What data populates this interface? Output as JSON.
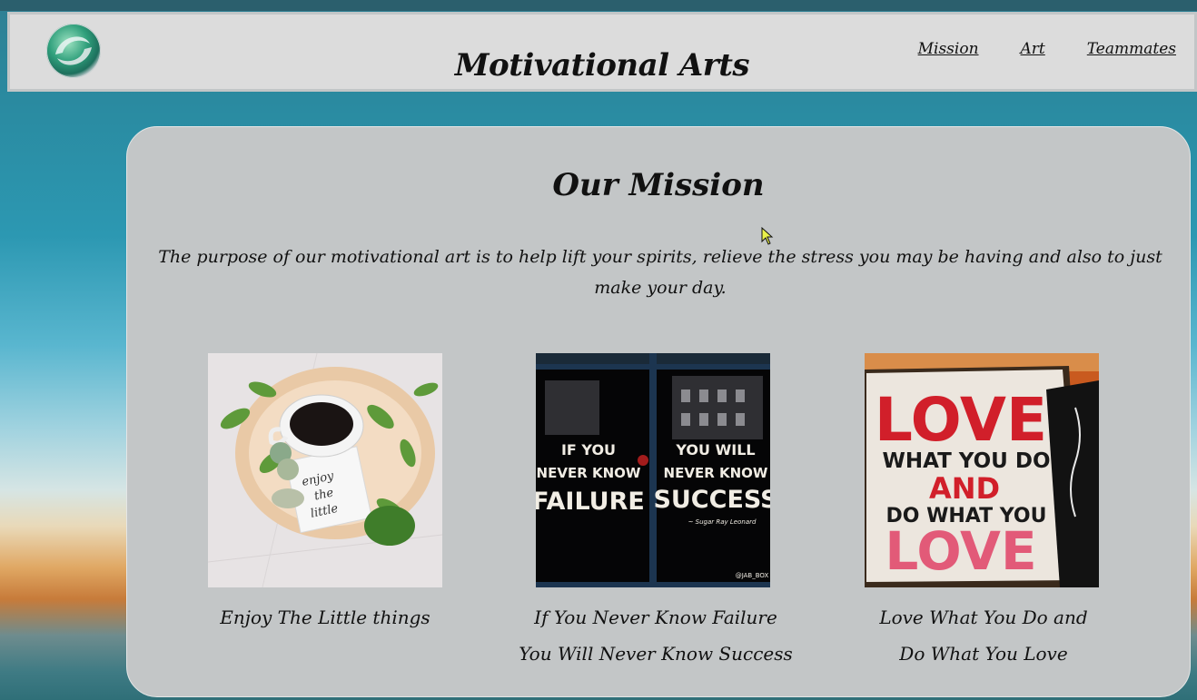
{
  "site": {
    "title": "Motivational Arts",
    "logo_icon": "swirl-logo-icon"
  },
  "nav": {
    "items": [
      {
        "label": "Mission"
      },
      {
        "label": "Art"
      },
      {
        "label": "Teammates"
      }
    ]
  },
  "mission": {
    "title": "Our Mission",
    "text": "The purpose of our motivational art is to help lift your spirits, relieve the stress you may be having and also to just make your day."
  },
  "gallery": [
    {
      "image_icon": "coffee-and-leaves-photo",
      "caption_lines": [
        "Enjoy The Little things",
        ""
      ],
      "image_text": "enjoy the little things"
    },
    {
      "image_icon": "window-quote-photo",
      "caption_lines": [
        "If You Never Know Failure",
        "You Will Never Know Success"
      ],
      "image_text": {
        "left": [
          "IF YOU",
          "NEVER KNOW",
          "FAILURE"
        ],
        "right": [
          "YOU WILL",
          "NEVER KNOW",
          "SUCCESS"
        ],
        "credit": "~ Sugar Ray Leonard",
        "tag": "@JAB_BOX"
      }
    },
    {
      "image_icon": "love-sign-photo",
      "caption_lines": [
        "Love What You Do and",
        "Do What You Love"
      ],
      "image_text": [
        "LOVE",
        "WHAT YOU DO",
        "AND",
        "DO WHAT YOU",
        "LOVE"
      ]
    }
  ],
  "colors": {
    "nav_bg": "#dcdcdc",
    "card_bg": "#c3c6c7",
    "text": "#111111",
    "love_red": "#d11f2a",
    "love_pink": "#e25a78"
  }
}
